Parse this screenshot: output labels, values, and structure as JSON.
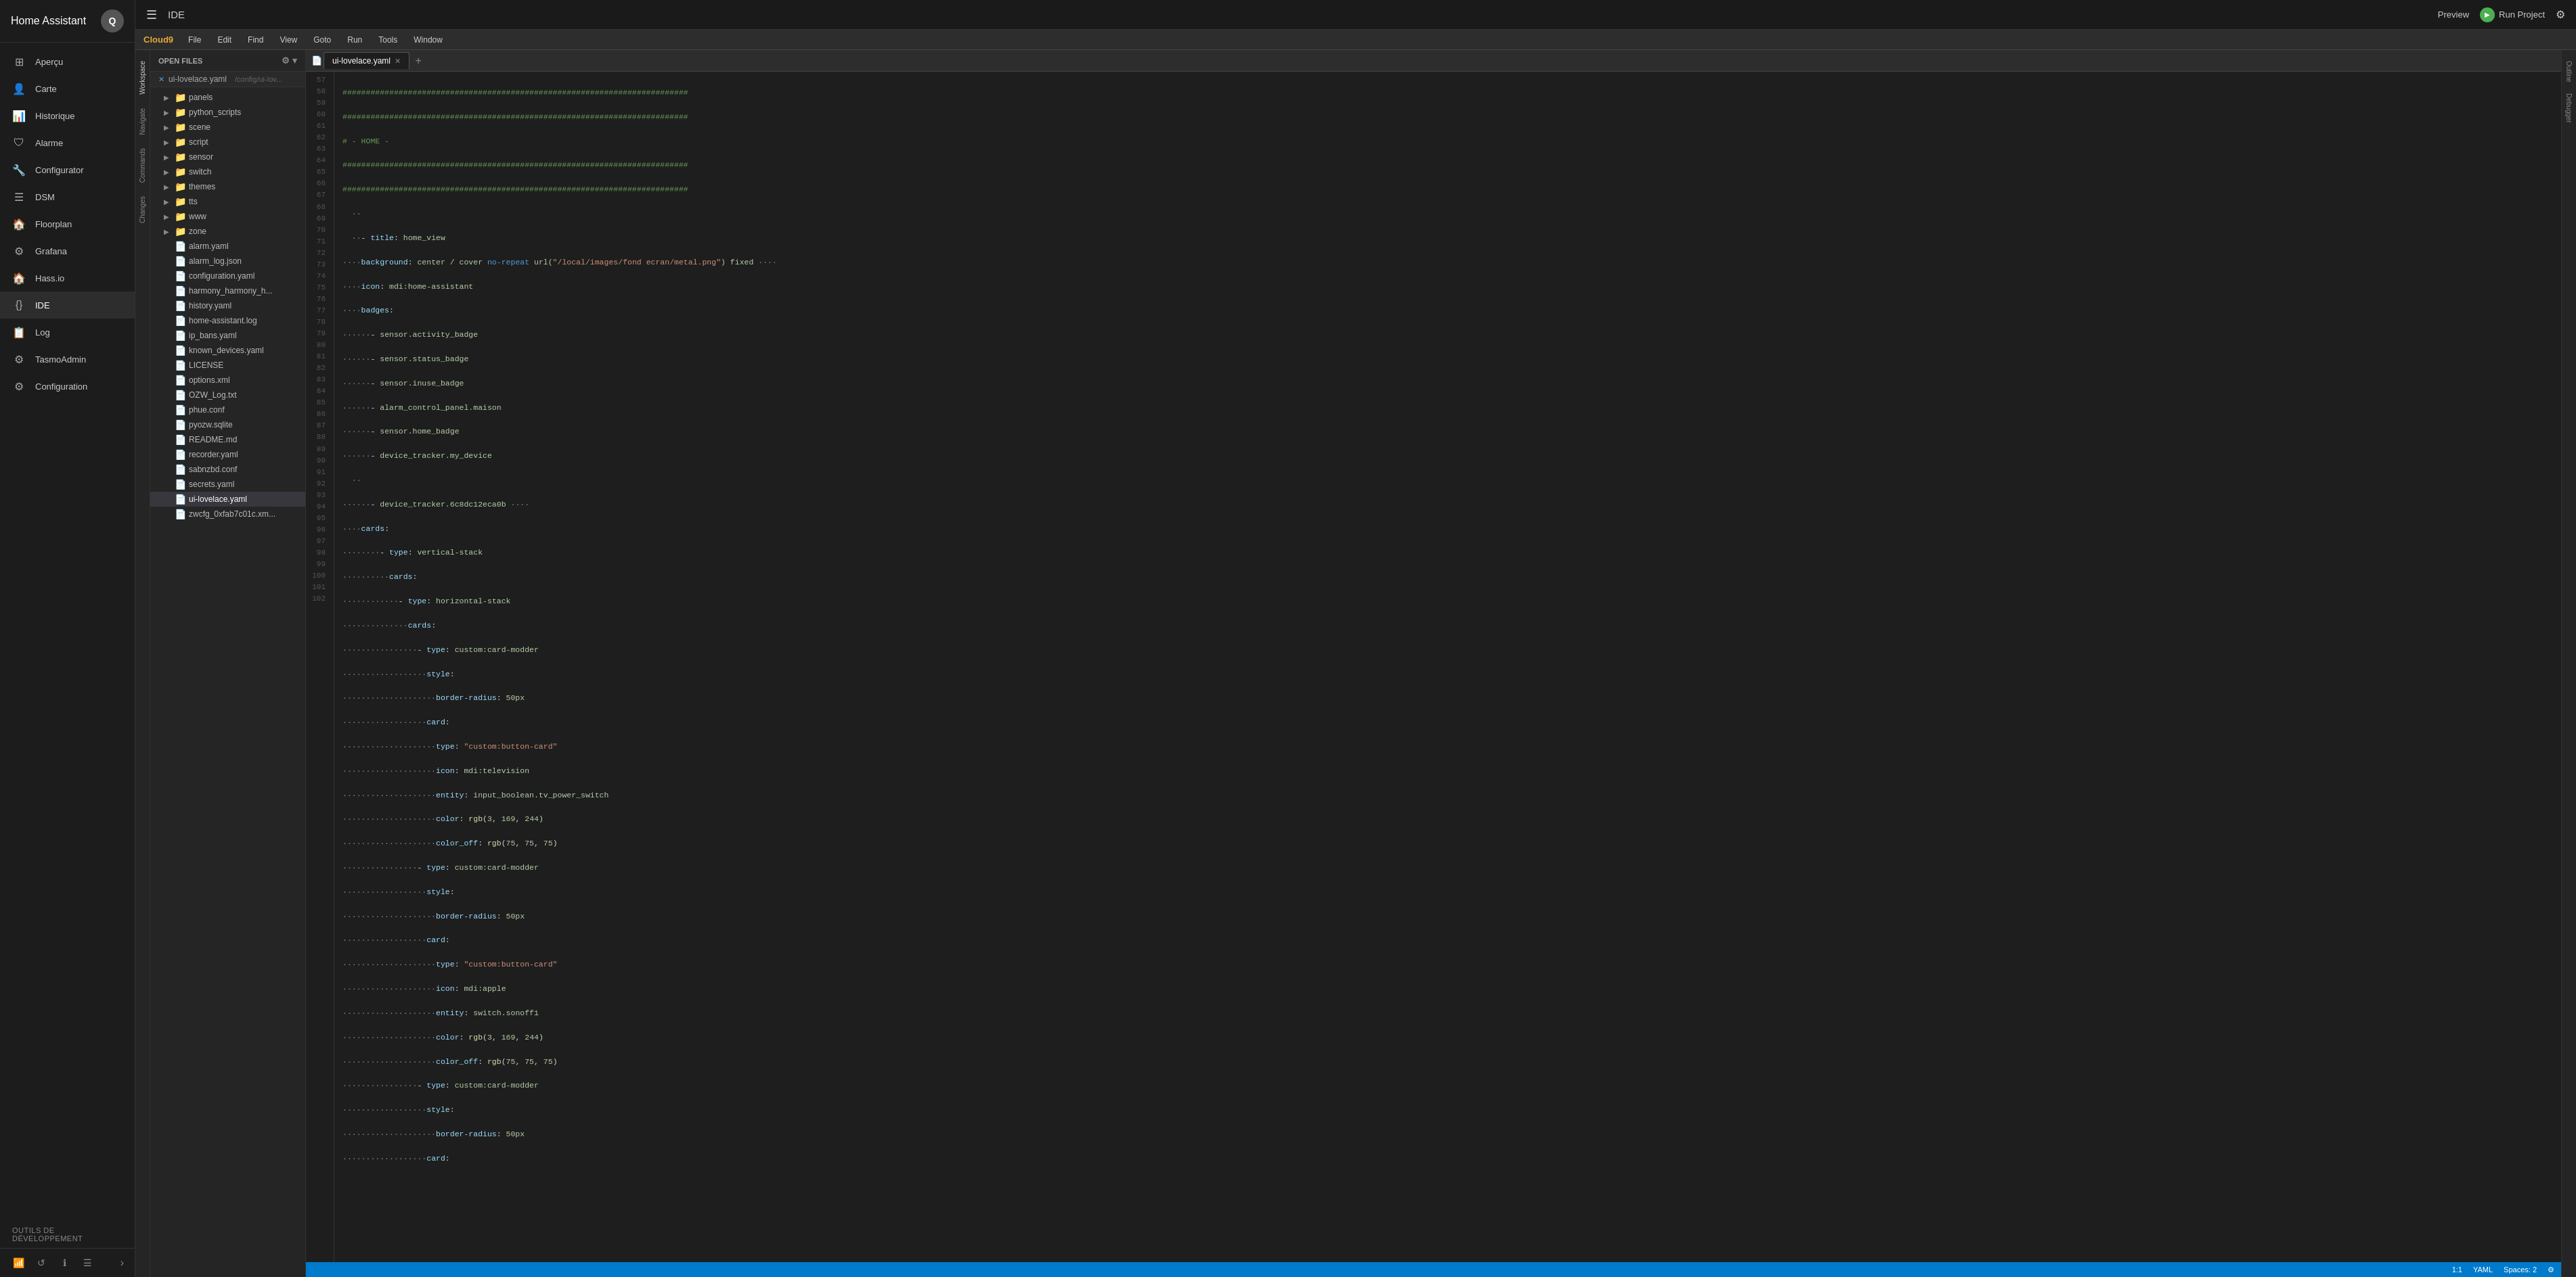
{
  "ha": {
    "title": "Home Assistant",
    "avatar_letter": "Q",
    "nav_items": [
      {
        "id": "apercu",
        "label": "Aperçu",
        "icon": "⊞"
      },
      {
        "id": "carte",
        "label": "Carte",
        "icon": "👤"
      },
      {
        "id": "historique",
        "label": "Historique",
        "icon": "📊"
      },
      {
        "id": "alarme",
        "label": "Alarme",
        "icon": "🛡"
      },
      {
        "id": "configurator",
        "label": "Configurator",
        "icon": "🔧"
      },
      {
        "id": "dsm",
        "label": "DSM",
        "icon": "☰"
      },
      {
        "id": "floorplan",
        "label": "Floorplan",
        "icon": "🏠"
      },
      {
        "id": "grafana",
        "label": "Grafana",
        "icon": "⚙"
      },
      {
        "id": "hass_io",
        "label": "Hass.io",
        "icon": "🏠"
      },
      {
        "id": "ide",
        "label": "IDE",
        "icon": "{}"
      },
      {
        "id": "log",
        "label": "Log",
        "icon": "📋"
      },
      {
        "id": "tasmoadmin",
        "label": "TasmoAdmin",
        "icon": "⚙"
      },
      {
        "id": "configuration",
        "label": "Configuration",
        "icon": "⚙"
      }
    ],
    "dev_tools": "Outils de développement"
  },
  "ide": {
    "title": "IDE",
    "menu_items": [
      "Cloud9",
      "File",
      "Edit",
      "Find",
      "View",
      "Goto",
      "Run",
      "Tools",
      "Window"
    ],
    "preview_label": "Preview",
    "run_label": "Run Project"
  },
  "file_panel": {
    "header": "OPEN FILES",
    "open_file": "ui-lovelace.yaml",
    "open_file_path": "/config/ui-lov...",
    "folders": [
      "panels",
      "python_scripts",
      "scene",
      "script",
      "sensor",
      "switch",
      "themes",
      "tts",
      "www",
      "zone"
    ],
    "files": [
      {
        "name": "alarm.yaml",
        "type": "yaml"
      },
      {
        "name": "alarm_log.json",
        "type": "json"
      },
      {
        "name": "configuration.yaml",
        "type": "yaml"
      },
      {
        "name": "harmony_harmony_h...",
        "type": "yaml"
      },
      {
        "name": "history.yaml",
        "type": "yaml"
      },
      {
        "name": "home-assistant.log",
        "type": "file"
      },
      {
        "name": "ip_bans.yaml",
        "type": "yaml"
      },
      {
        "name": "known_devices.yaml",
        "type": "yaml"
      },
      {
        "name": "LICENSE",
        "type": "file"
      },
      {
        "name": "options.xml",
        "type": "xml"
      },
      {
        "name": "OZW_Log.txt",
        "type": "file"
      },
      {
        "name": "phue.conf",
        "type": "file"
      },
      {
        "name": "pyozw.sqlite",
        "type": "file"
      },
      {
        "name": "README.md",
        "type": "file"
      },
      {
        "name": "recorder.yaml",
        "type": "yaml"
      },
      {
        "name": "sabnzbd.conf",
        "type": "file"
      },
      {
        "name": "secrets.yaml",
        "type": "yaml"
      },
      {
        "name": "ui-lovelace.yaml",
        "type": "yaml",
        "active": true
      },
      {
        "name": "zwcfg_0xfab7c01c.xm...",
        "type": "xml"
      }
    ]
  },
  "editor": {
    "tab_label": "ui-lovelace.yaml",
    "status": {
      "position": "1:1",
      "language": "YAML",
      "spaces": "Spaces: 2",
      "settings": "⚙"
    },
    "lines": [
      {
        "num": 57,
        "content": "##########################################################################"
      },
      {
        "num": 58,
        "content": "##########################################################################"
      },
      {
        "num": 59,
        "content": "# - HOME -"
      },
      {
        "num": 60,
        "content": "##########################################################################"
      },
      {
        "num": 61,
        "content": "##########################################################################"
      },
      {
        "num": 62,
        "content": "  ··"
      },
      {
        "num": 63,
        "content": "  ··- title: home_view"
      },
      {
        "num": 64,
        "content": "····background: center / cover no-repeat url(\"/local/images/fond ecran/metal.png\") fixed ····"
      },
      {
        "num": 65,
        "content": "····icon: mdi:home-assistant"
      },
      {
        "num": 66,
        "content": "····badges:"
      },
      {
        "num": 67,
        "content": "······- sensor.activity_badge"
      },
      {
        "num": 68,
        "content": "······- sensor.status_badge"
      },
      {
        "num": 69,
        "content": "······- sensor.inuse_badge"
      },
      {
        "num": 70,
        "content": "······- alarm_control_panel.maison"
      },
      {
        "num": 71,
        "content": "······- sensor.home_badge"
      },
      {
        "num": 72,
        "content": "······- device_tracker.my_device"
      },
      {
        "num": 73,
        "content": "  ··"
      },
      {
        "num": 74,
        "content": "······- device_tracker.6c8dc12eca0b ····"
      },
      {
        "num": 75,
        "content": "····cards:"
      },
      {
        "num": 76,
        "content": "········- type: vertical-stack"
      },
      {
        "num": 77,
        "content": "··········cards:"
      },
      {
        "num": 78,
        "content": "············- type: horizontal-stack"
      },
      {
        "num": 79,
        "content": "··············cards:"
      },
      {
        "num": 80,
        "content": "················- type: custom:card-modder"
      },
      {
        "num": 81,
        "content": "··················style:"
      },
      {
        "num": 82,
        "content": "····················border-radius: 50px"
      },
      {
        "num": 83,
        "content": "··················card:"
      },
      {
        "num": 84,
        "content": "····················type: \"custom:button-card\""
      },
      {
        "num": 85,
        "content": "····················icon: mdi:television"
      },
      {
        "num": 86,
        "content": "····················entity: input_boolean.tv_power_switch"
      },
      {
        "num": 87,
        "content": "····················color: rgb(3, 169, 244)"
      },
      {
        "num": 88,
        "content": "····················color_off: rgb(75, 75, 75)"
      },
      {
        "num": 89,
        "content": "················- type: custom:card-modder"
      },
      {
        "num": 90,
        "content": "··················style:"
      },
      {
        "num": 91,
        "content": "····················border-radius: 50px"
      },
      {
        "num": 92,
        "content": "··················card:"
      },
      {
        "num": 93,
        "content": "····················type: \"custom:button-card\""
      },
      {
        "num": 94,
        "content": "····················icon: mdi:apple"
      },
      {
        "num": 95,
        "content": "····················entity: switch.sonoff1"
      },
      {
        "num": 96,
        "content": "····················color: rgb(3, 169, 244)"
      },
      {
        "num": 97,
        "content": "····················color_off: rgb(75, 75, 75)"
      },
      {
        "num": 98,
        "content": "················- type: custom:card-modder"
      },
      {
        "num": 99,
        "content": "··················style:"
      },
      {
        "num": 100,
        "content": "····················border-radius: 50px"
      },
      {
        "num": 101,
        "content": "··················card:"
      },
      {
        "num": 102,
        "content": "  "
      }
    ]
  },
  "sidebar_tabs": [
    "Workspace",
    "Navigate",
    "Commands",
    "Changes"
  ],
  "right_tabs": [
    "Outline",
    "Debugger"
  ]
}
